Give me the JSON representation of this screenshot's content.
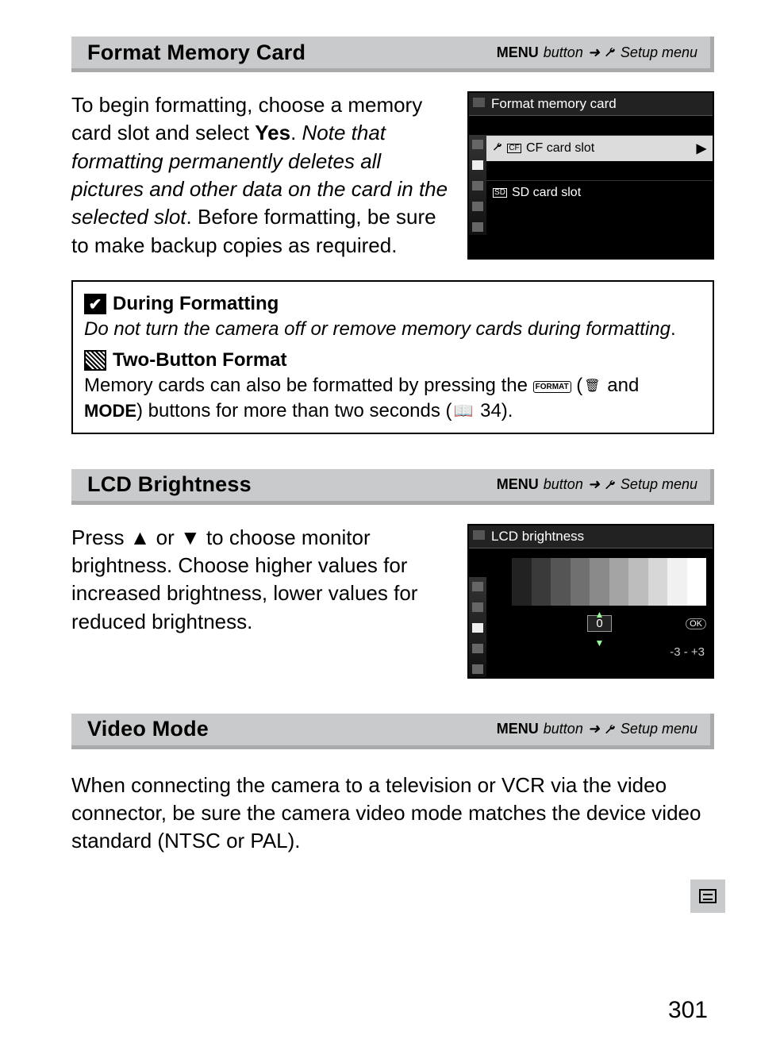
{
  "sections": {
    "format": {
      "title": "Format Memory Card",
      "path_menu": "MENU",
      "path_button": " button",
      "path_setup": "Setup menu",
      "body_pre": "To begin formatting, choose a memory card slot and select ",
      "body_yes": "Yes",
      "body_mid": ".  ",
      "body_ital": "Note that formatting permanently deletes all pictures and other data on the card in the selected slot",
      "body_post": ".  Before formatting, be sure to make backup copies as required.",
      "lcd": {
        "title": "Format memory card",
        "row1_label": "CF card slot",
        "row1_prefix": "CF",
        "row2_label": "SD card slot",
        "row2_prefix": "SD"
      }
    },
    "lcd_brightness": {
      "title": "LCD Brightness",
      "path_menu": "MENU",
      "path_button": " button",
      "path_setup": "Setup menu",
      "body": "Press ▲ or ▼ to choose monitor brightness.  Choose higher values for increased brightness, lower values for reduced brightness.",
      "lcd": {
        "title": "LCD brightness",
        "value": "0",
        "ok": "OK",
        "range": "-3 - +3"
      }
    },
    "video": {
      "title": "Video Mode",
      "path_menu": "MENU",
      "path_button": " button",
      "path_setup": "Setup menu",
      "body": "When connecting the camera to a television or VCR via the video connector, be sure the camera video mode matches the device video standard (NTSC or PAL)."
    }
  },
  "notes": {
    "n1_title": "During Formatting",
    "n1_body": "Do not turn the camera off or remove memory cards during formatting",
    "n2_title": "Two-Button Format",
    "n2_pre": "Memory cards can also be formatted by pressing the ",
    "n2_format_label": "FORMAT",
    "n2_mid1": " (",
    "n2_trash": "🗑",
    "n2_mid2": " and ",
    "n2_mode": "MODE",
    "n2_mid3": ") buttons for more than two seconds (",
    "n2_book": "📖",
    "n2_page": " 34)."
  },
  "page_number": "301"
}
